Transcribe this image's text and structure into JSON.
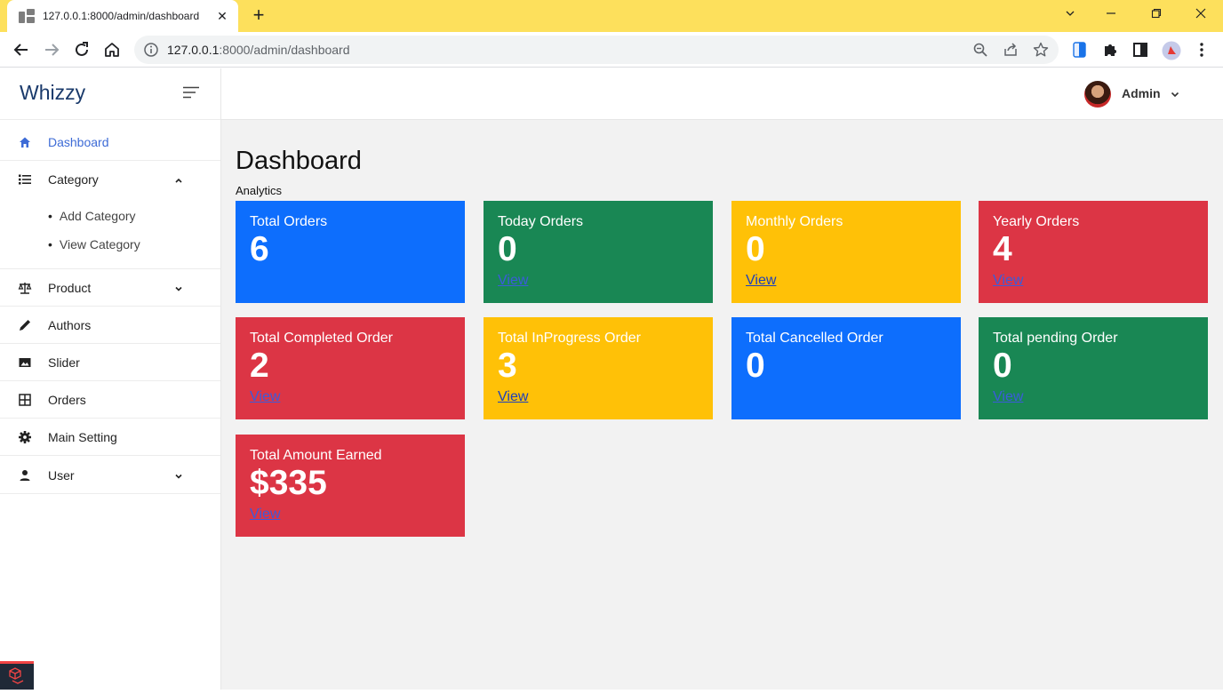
{
  "browser": {
    "tab_title": "127.0.0.1:8000/admin/dashboard",
    "url_host": "127.0.0.1",
    "url_path": ":8000/admin/dashboard"
  },
  "app": {
    "brand": "Whizzy"
  },
  "sidebar": {
    "items": [
      {
        "label": "Dashboard",
        "icon": "home-icon",
        "active": true
      },
      {
        "label": "Category",
        "icon": "list-icon",
        "expanded": true,
        "children": [
          "Add Category",
          "View Category"
        ]
      },
      {
        "label": "Product",
        "icon": "scale-icon",
        "expanded": false
      },
      {
        "label": "Authors",
        "icon": "pen-icon"
      },
      {
        "label": "Slider",
        "icon": "image-icon"
      },
      {
        "label": "Orders",
        "icon": "grid-icon"
      },
      {
        "label": "Main Setting",
        "icon": "gear-icon"
      },
      {
        "label": "User",
        "icon": "person-icon",
        "expanded": false
      }
    ]
  },
  "topbar": {
    "user_name": "Admin"
  },
  "page": {
    "title": "Dashboard",
    "subtitle": "Analytics"
  },
  "colors": {
    "blue": "#0d6efd",
    "green": "#198754",
    "yellow": "#ffc107",
    "red": "#dc3545",
    "link": "#3b5bdb"
  },
  "cards": [
    {
      "title": "Total Orders",
      "value": "6",
      "color": "blue"
    },
    {
      "title": "Today Orders",
      "value": "0",
      "link": "View",
      "color": "green"
    },
    {
      "title": "Monthly Orders",
      "value": "0",
      "link": "View",
      "color": "yellow"
    },
    {
      "title": "Yearly Orders",
      "value": "4",
      "link": "View",
      "color": "red"
    },
    {
      "title": "Total Completed Order",
      "value": "2",
      "link": "View",
      "color": "red"
    },
    {
      "title": "Total InProgress Order",
      "value": "3",
      "link": "View",
      "color": "yellow"
    },
    {
      "title": "Total Cancelled Order",
      "value": "0",
      "color": "blue"
    },
    {
      "title": "Total pending Order",
      "value": "0",
      "link": "View",
      "color": "green"
    },
    {
      "title": "Total Amount Earned",
      "value": "$335",
      "link": "View",
      "color": "red"
    }
  ]
}
